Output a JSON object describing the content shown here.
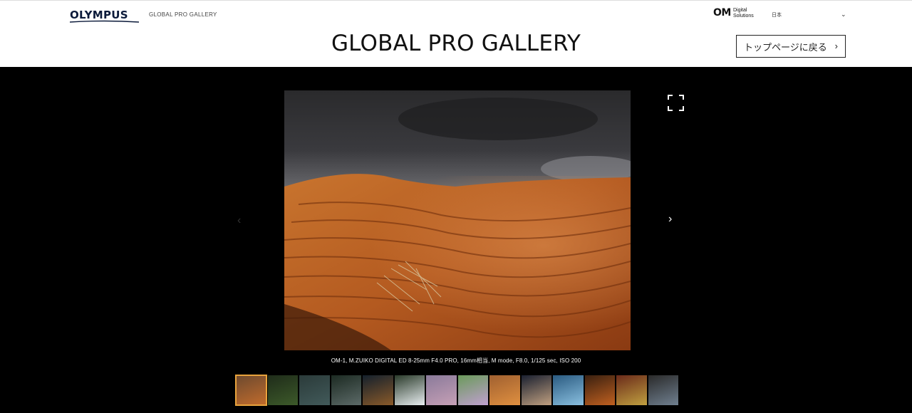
{
  "header": {
    "brand": "OLYMPUS",
    "subtitle": "GLOBAL PRO GALLERY",
    "om_logo": "OM",
    "om_logo_text_line1": "Digital",
    "om_logo_text_line2": "Solutions",
    "language": "日本",
    "title": "GLOBAL PRO GALLERY",
    "back_button_label": "トップページに戻る"
  },
  "viewer": {
    "caption": "OM-1, M.ZUIKO DIGITAL ED 8-25mm F4.0 PRO, 16mm相当, M mode, F8.0, 1/125 sec, ISO 200",
    "active_thumb_index": 0,
    "thumbnails": [
      {
        "colors": [
          "#6e4a2f",
          "#c06b2c"
        ]
      },
      {
        "colors": [
          "#1f2c1a",
          "#3d5a2a"
        ]
      },
      {
        "colors": [
          "#2b3b3a",
          "#425a5a"
        ]
      },
      {
        "colors": [
          "#1c2a22",
          "#5c6a68"
        ]
      },
      {
        "colors": [
          "#14202c",
          "#8a5a2a"
        ]
      },
      {
        "colors": [
          "#2a3a2a",
          "#e8eef0"
        ]
      },
      {
        "colors": [
          "#8a7a9a",
          "#c6a0b6"
        ]
      },
      {
        "colors": [
          "#6a9a5a",
          "#c0a0d0"
        ]
      },
      {
        "colors": [
          "#a06030",
          "#e09040"
        ]
      },
      {
        "colors": [
          "#1a2030",
          "#c0a080"
        ]
      },
      {
        "colors": [
          "#2a5a80",
          "#8ac0e0"
        ]
      },
      {
        "colors": [
          "#3a2010",
          "#c06020"
        ]
      },
      {
        "colors": [
          "#6a2a1a",
          "#c0a040"
        ]
      },
      {
        "colors": [
          "#2a2a2a",
          "#708090"
        ]
      }
    ]
  },
  "colors": {
    "accent": "#e8a33c",
    "stage_bg": "#000000"
  }
}
